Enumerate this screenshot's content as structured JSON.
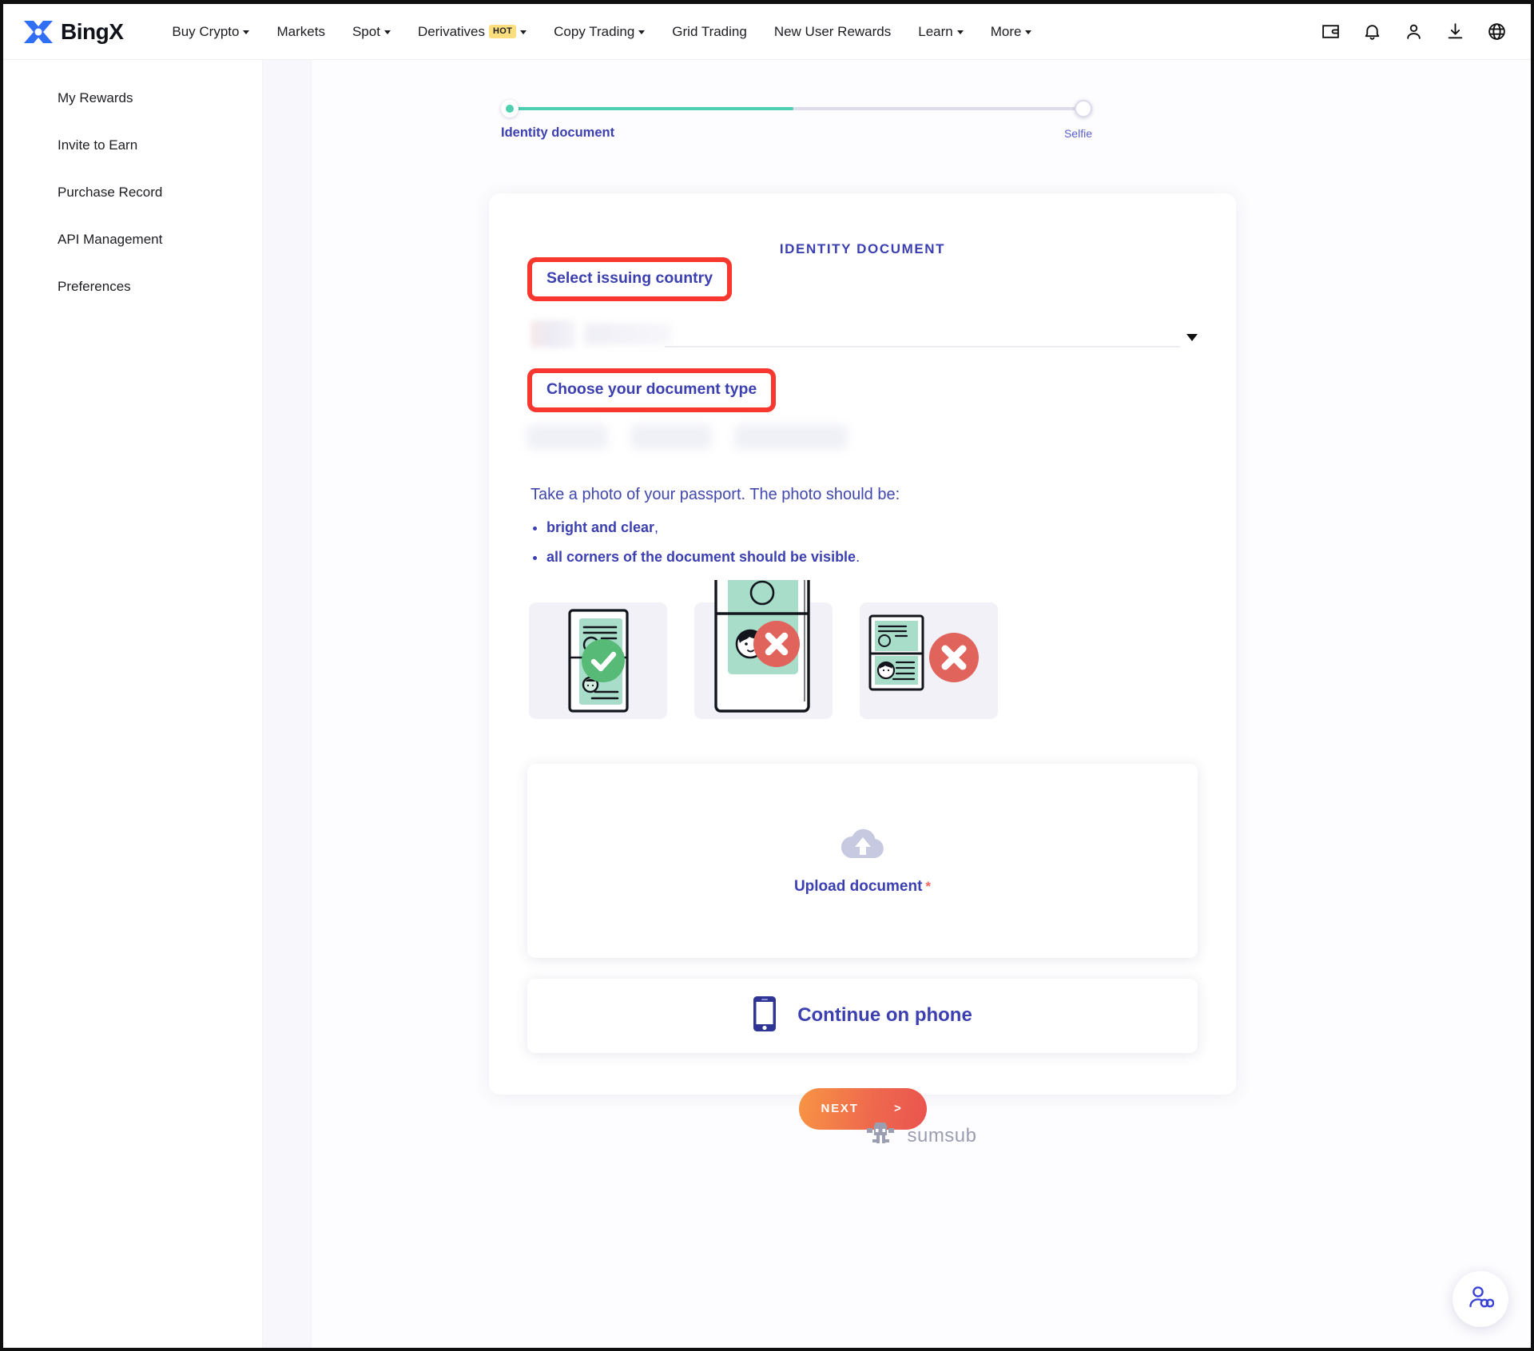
{
  "brand": {
    "name": "BingX",
    "logo_icon": "bingx-logo-icon"
  },
  "navbar": {
    "items": [
      {
        "label": "Buy Crypto",
        "has_caret": true,
        "badge": ""
      },
      {
        "label": "Markets",
        "has_caret": false,
        "badge": ""
      },
      {
        "label": "Spot",
        "has_caret": true,
        "badge": ""
      },
      {
        "label": "Derivatives",
        "has_caret": true,
        "badge": "HOT"
      },
      {
        "label": "Copy Trading",
        "has_caret": true,
        "badge": ""
      },
      {
        "label": "Grid Trading",
        "has_caret": false,
        "badge": ""
      },
      {
        "label": "New User Rewards",
        "has_caret": false,
        "badge": ""
      },
      {
        "label": "Learn",
        "has_caret": true,
        "badge": ""
      },
      {
        "label": "More",
        "has_caret": true,
        "badge": ""
      }
    ],
    "icons": [
      {
        "name": "wallet-icon"
      },
      {
        "name": "bell-icon"
      },
      {
        "name": "user-icon"
      },
      {
        "name": "download-icon"
      },
      {
        "name": "globe-icon"
      }
    ]
  },
  "sidebar": {
    "items": [
      {
        "label": "My Rewards"
      },
      {
        "label": "Invite to Earn"
      },
      {
        "label": "Purchase Record"
      },
      {
        "label": "API Management"
      },
      {
        "label": "Preferences"
      }
    ]
  },
  "stepper": {
    "current_step_label": "Identity document",
    "next_step_label": "Selfie",
    "progress_percent": 49,
    "active_color": "#4ecfb0",
    "inactive_color": "#dcdcea"
  },
  "kyc": {
    "title": "IDENTITY DOCUMENT",
    "country_label": "Select issuing country",
    "country_value": "",
    "doctype_label": "Choose your document type",
    "instructions_heading": "Take a photo of your passport. The photo should be:",
    "bullets": [
      {
        "strong": "bright and clear",
        "tail": ","
      },
      {
        "strong": "all corners of the document should be visible",
        "tail": "."
      }
    ],
    "examples": [
      {
        "name": "good-document-example",
        "status": "ok"
      },
      {
        "name": "cropped-document-example",
        "status": "bad"
      },
      {
        "name": "incomplete-document-example",
        "status": "bad"
      }
    ],
    "upload_label": "Upload document",
    "upload_required_marker": "*",
    "phone_label": "Continue on phone",
    "next_label": "NEXT",
    "next_arrow": ">",
    "highlight_color": "#f8382f",
    "accent_color": "#3b3fb0"
  },
  "footer": {
    "provider": "sumsub",
    "provider_icon": "sumsub-robot-icon"
  },
  "support": {
    "icon": "support-agent-icon",
    "color": "#3b42d6"
  }
}
